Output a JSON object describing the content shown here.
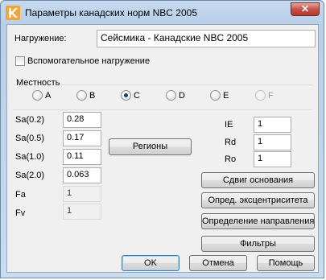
{
  "window": {
    "title": "Параметры канадских норм NBC 2005",
    "close_glyph": "✕"
  },
  "load": {
    "label": "Нагружение:",
    "value": "Сейсмика - Канадские NBC 2005"
  },
  "aux_load": {
    "label": "Вспомогательное нагружение",
    "checked": false
  },
  "terrain": {
    "label": "Местность",
    "options": [
      {
        "label": "A",
        "checked": false,
        "enabled": true
      },
      {
        "label": "B",
        "checked": false,
        "enabled": true
      },
      {
        "label": "C",
        "checked": true,
        "enabled": true
      },
      {
        "label": "D",
        "checked": false,
        "enabled": true
      },
      {
        "label": "E",
        "checked": false,
        "enabled": true
      },
      {
        "label": "F",
        "checked": false,
        "enabled": false
      }
    ]
  },
  "spectral": [
    {
      "label": "Sa(0.2)",
      "value": "0.28"
    },
    {
      "label": "Sa(0.5)",
      "value": "0.17"
    },
    {
      "label": "Sa(1.0)",
      "value": "0.11"
    },
    {
      "label": "Sa(2.0)",
      "value": "0.063"
    }
  ],
  "factors": [
    {
      "label": "Fa",
      "value": "1"
    },
    {
      "label": "Fv",
      "value": "1"
    }
  ],
  "coefficients": [
    {
      "label": "IE",
      "value": "1"
    },
    {
      "label": "Rd",
      "value": "1"
    },
    {
      "label": "Ro",
      "value": "1"
    }
  ],
  "buttons": {
    "regions": "Регионы",
    "base_shift": "Сдвиг основания",
    "eccentricity": "Опред. эксцентриситета",
    "direction": "Определение направления",
    "filters": "Фильтры",
    "ok": "OK",
    "cancel": "Отмена",
    "help": "Помощь"
  }
}
